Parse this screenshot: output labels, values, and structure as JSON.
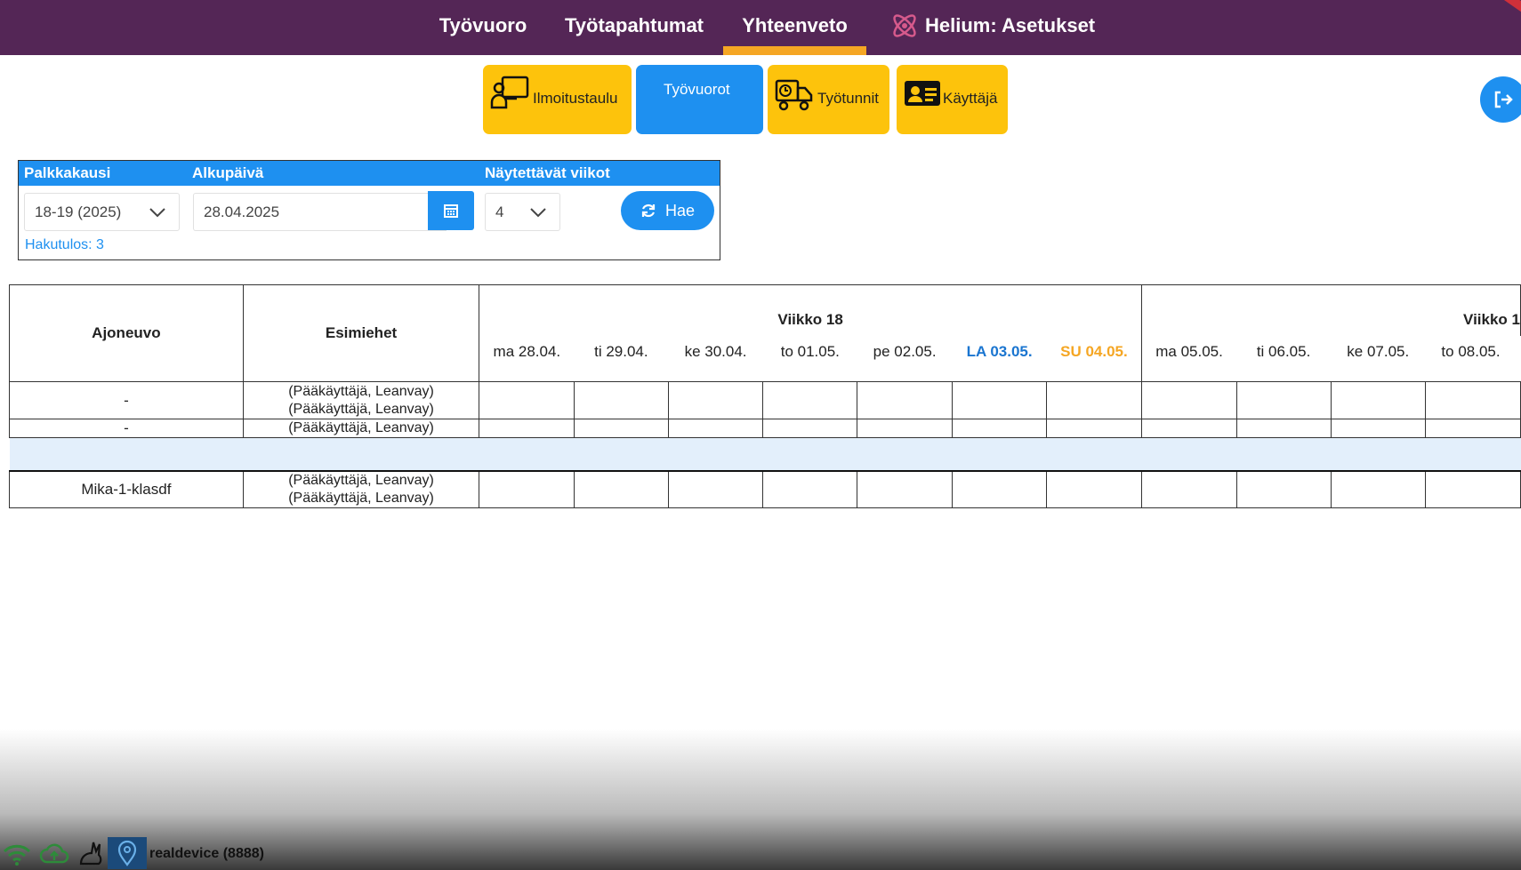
{
  "nav": {
    "tabs": [
      {
        "label": "Työvuoro"
      },
      {
        "label": "Työtapahtumat"
      },
      {
        "label": "Yhteenveto",
        "active": true
      },
      {
        "label": "Helium: Asetukset"
      }
    ]
  },
  "modules": {
    "ilmoitustaulu": "Ilmoitustaulu",
    "tyovuorot": "Työvuorot",
    "tyotunnit": "Työtunnit",
    "kayttaja": "Käyttäjä"
  },
  "filter": {
    "palkkakausi_label": "Palkkakausi",
    "alkupaiva_label": "Alkupäivä",
    "viikot_label": "Näytettävät viikot",
    "palkkakausi_value": "18-19 (2025)",
    "alkupaiva_value": "28.04.2025",
    "viikot_value": "4",
    "hae_label": "Hae",
    "result": "Hakutulos: 3"
  },
  "table": {
    "col_vehicle": "Ajoneuvo",
    "col_managers": "Esimiehet",
    "weeks": [
      "Viikko 18",
      "Viikko 1"
    ],
    "days": [
      "ma 28.04.",
      "ti 29.04.",
      "ke 30.04.",
      "to 01.05.",
      "pe 02.05.",
      "LA 03.05.",
      "SU 04.05.",
      "ma 05.05.",
      "ti 06.05.",
      "ke 07.05.",
      "to 08.05."
    ],
    "rows": [
      {
        "vehicle": "-",
        "managers": [
          "(Pääkäyttäjä, Leanvay)",
          "(Pääkäyttäjä, Leanvay)"
        ]
      },
      {
        "vehicle": "-",
        "managers": [
          "(Pääkäyttäjä, Leanvay)"
        ]
      },
      {
        "vehicle": "Mika-1-klasdf",
        "managers": [
          "(Pääkäyttäjä, Leanvay)",
          "(Pääkäyttäjä, Leanvay)"
        ]
      }
    ]
  },
  "status": {
    "device": "realdevice (8888)",
    "icons": [
      "wifi-icon",
      "cloud-upload-icon",
      "rabbit-icon",
      "location-pin-icon"
    ]
  },
  "colors": {
    "nav_bg": "#542656",
    "accent_orange": "#f5a623",
    "module_yellow": "#fdc30c",
    "primary_blue": "#1e90f0",
    "saturday_blue": "#1a75d0"
  }
}
